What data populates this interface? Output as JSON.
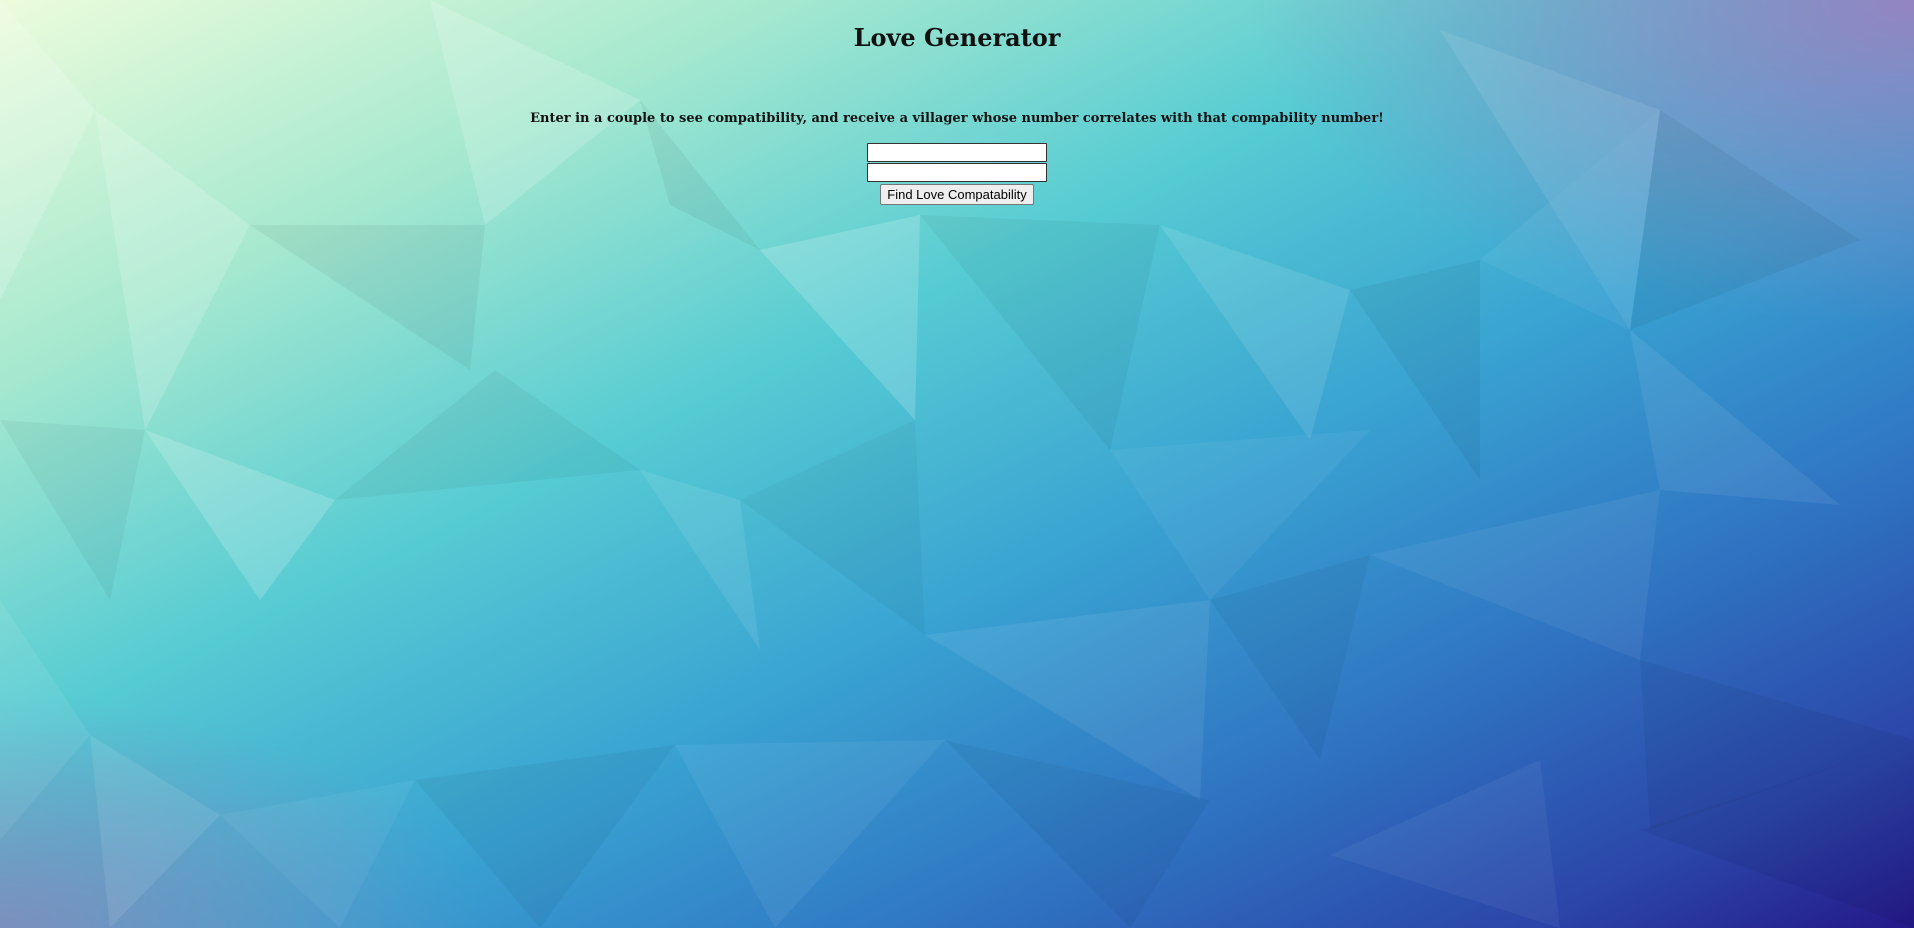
{
  "page": {
    "title": "Love Generator",
    "subtitle": "Enter in a couple to see compatibility, and receive a villager whose number correlates with that compability number!"
  },
  "form": {
    "first_name_value": "",
    "second_name_value": "",
    "submit_label": "Find Love Compatability"
  },
  "colors": {
    "bg_top_left": "#e6fbe0",
    "bg_mint": "#9fe6c8",
    "bg_teal": "#5ccfd2",
    "bg_blue": "#2f7fc9",
    "bg_bottom_right": "#261b8e",
    "bg_top_right_purple": "#9a86c0"
  }
}
